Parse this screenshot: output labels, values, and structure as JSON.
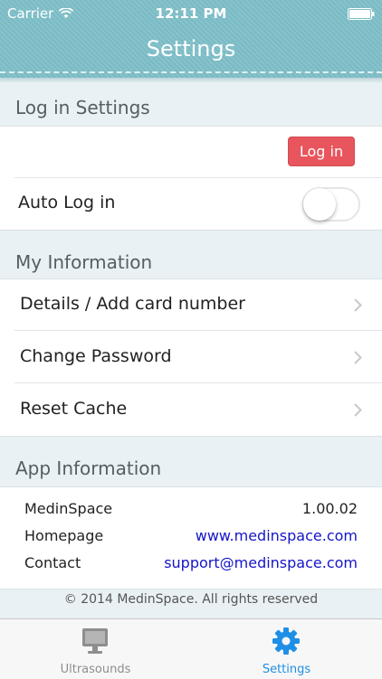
{
  "status_bar": {
    "carrier": "Carrier",
    "time": "12:11 PM"
  },
  "nav": {
    "title": "Settings"
  },
  "login_section": {
    "title": "Log in Settings",
    "login_button": "Log in",
    "auto_login_label": "Auto Log in",
    "auto_login_on": false
  },
  "my_info": {
    "title": "My Information",
    "items": [
      {
        "label": "Details / Add card number"
      },
      {
        "label": "Change Password"
      },
      {
        "label": "Reset Cache"
      }
    ]
  },
  "app_info": {
    "title": "App Information",
    "rows": [
      {
        "label": "MedinSpace",
        "value": "1.00.02"
      },
      {
        "label": "Homepage",
        "value": "www.medinspace.com"
      },
      {
        "label": "Contact",
        "value": "support@medinspace.com"
      }
    ]
  },
  "footer": {
    "copyright": "© 2014 MedinSpace. All rights reserved"
  },
  "tabbar": {
    "tabs": [
      {
        "label": "Ultrasounds",
        "icon": "monitor-icon",
        "selected": false
      },
      {
        "label": "Settings",
        "icon": "gear-icon",
        "selected": true
      }
    ]
  },
  "colors": {
    "header": "#7fc0c9",
    "login_button": "#e8555c",
    "link": "#1515c8",
    "tab_selected": "#1e8fe6",
    "tab_unselected": "#8e8e8e"
  }
}
